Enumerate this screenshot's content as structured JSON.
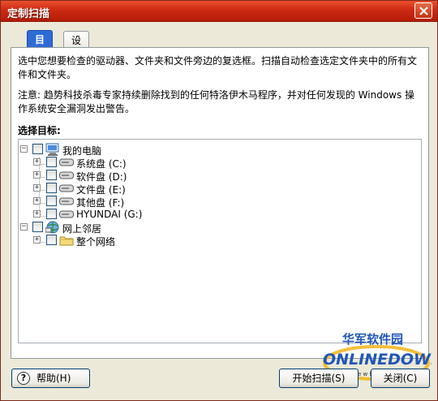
{
  "window": {
    "title": "定制扫描"
  },
  "tabs": [
    {
      "label": "目标",
      "active": true
    },
    {
      "label": "设置",
      "active": false
    }
  ],
  "description": "选中您想要检查的驱动器、文件夹和文件旁边的复选框。扫描自动检查选定文件夹中的所有文件和文件夹。",
  "note": "注意: 趋势科技杀毒专家持续删除找到的任何特洛伊木马程序，并对任何发现的 Windows 操作系统安全漏洞发出警告。",
  "target_label": "选择目标:",
  "tree": {
    "my_computer": "我的电脑",
    "drives": [
      {
        "label": "系统盘 (C:)"
      },
      {
        "label": "软件盘 (D:)"
      },
      {
        "label": "文件盘 (E:)"
      },
      {
        "label": "其他盘 (F:)"
      },
      {
        "label": "HYUNDAI (G:)"
      }
    ],
    "network": "网上邻居",
    "entire_network": "整个网络"
  },
  "buttons": {
    "help": "帮助(H)",
    "start": "开始扫描(S)",
    "close": "关闭(C)"
  },
  "watermark": {
    "cn": "华军软件园",
    "brand": "ONLINEDOWN",
    "url": "w w w . n e w h u a . c o m"
  },
  "colors": {
    "titlebar": "#cd2a12",
    "active_tab": "#2e6bd6",
    "brand": "#1f56b8"
  },
  "icons": [
    "close-icon",
    "computer-icon",
    "drive-icon",
    "network-icon",
    "folder-icon",
    "help-icon"
  ]
}
